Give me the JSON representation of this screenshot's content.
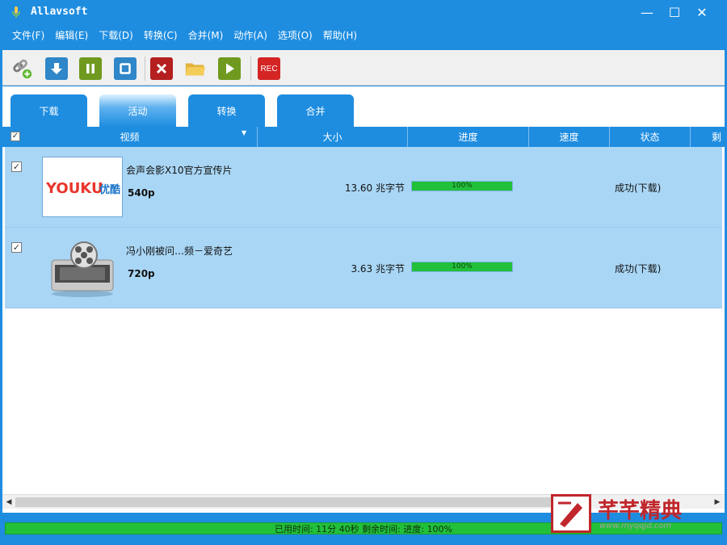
{
  "app": {
    "title": "Allavsoft",
    "icon": "microphone-icon"
  },
  "window_controls": {
    "minimize": "—",
    "maximize": "☐",
    "close": "✕"
  },
  "menu": [
    {
      "label": "文件(F)"
    },
    {
      "label": "编辑(E)"
    },
    {
      "label": "下载(D)"
    },
    {
      "label": "转换(C)"
    },
    {
      "label": "合并(M)"
    },
    {
      "label": "动作(A)"
    },
    {
      "label": "选项(O)"
    },
    {
      "label": "帮助(H)"
    }
  ],
  "toolbar": {
    "buttons": [
      {
        "name": "paste-url-icon"
      },
      {
        "name": "download-icon"
      },
      {
        "name": "pause-icon"
      },
      {
        "name": "stop-icon"
      },
      {
        "name": "delete-icon"
      },
      {
        "name": "open-folder-icon"
      },
      {
        "name": "play-icon"
      },
      {
        "name": "record-icon",
        "label": "REC"
      }
    ]
  },
  "tabs": [
    {
      "label": "下载"
    },
    {
      "label": "活动",
      "active": true
    },
    {
      "label": "转换"
    },
    {
      "label": "合并"
    }
  ],
  "columns": {
    "video": "视频",
    "size": "大小",
    "progress": "进度",
    "speed": "速度",
    "status": "状态",
    "remaining": "剩"
  },
  "rows": [
    {
      "checked": "✓",
      "title": "会声会影X10官方宣传片",
      "quality": "540p",
      "size": "13.60 兆字节",
      "progress": 100,
      "progress_label": "100%",
      "status": "成功(下载)",
      "thumb": {
        "brand_a": "YOUKU",
        "brand_b": "优酷"
      }
    },
    {
      "checked": "✓",
      "title": "冯小刚被问…频－爱奇艺",
      "quality": "720p",
      "size": "3.63 兆字节",
      "progress": 100,
      "progress_label": "100%",
      "status": "成功(下载)",
      "thumb": {
        "icon": "film-projector-icon"
      }
    }
  ],
  "statusbar": {
    "text": "已用时间: 11分 40秒 剩余时间:  进度: 100%",
    "progress": 100
  },
  "watermark": {
    "name": "芊芊精典",
    "url": "www.myqqjd.com"
  },
  "colors": {
    "accent": "#1e8de0",
    "row_selected": "#a9d6f5",
    "progress_green": "#22c03a",
    "watermark_red": "#c0262b"
  }
}
